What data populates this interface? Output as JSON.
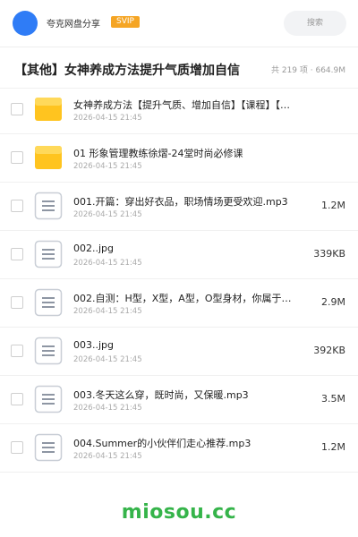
{
  "header": {
    "brand": "夸克网盘分享",
    "badge": "SVIP",
    "search_label": "搜索",
    "accent_color": "#2f7cf6",
    "badge_color": "#f5a524"
  },
  "title": "【其他】女神养成方法提升气质增加自信",
  "summary": "共 219 项 · 664.9M",
  "files": [
    {
      "type": "folder",
      "name": "女神养成方法【提升气质、增加自信】【课程】【音频】",
      "date": "2026-04-15 21:45",
      "size": ""
    },
    {
      "type": "folder",
      "name": "01 形象管理教练徐熠-24堂时尚必修课",
      "date": "2026-04-15 21:45",
      "size": ""
    },
    {
      "type": "file",
      "name": "001.开篇：穿出好衣品，职场情场更受欢迎.mp3",
      "date": "2026-04-15 21:45",
      "size": "1.2M"
    },
    {
      "type": "file",
      "name": "002..jpg",
      "date": "2026-04-15 21:45",
      "size": "339KB"
    },
    {
      "type": "file",
      "name": "002.自测：H型，X型，A型，O型身材，你属于哪…",
      "date": "2026-04-15 21:45",
      "size": "2.9M"
    },
    {
      "type": "file",
      "name": "003..jpg",
      "date": "2026-04-15 21:45",
      "size": "392KB"
    },
    {
      "type": "file",
      "name": "003.冬天这么穿，既时尚，又保暖.mp3",
      "date": "2026-04-15 21:45",
      "size": "3.5M"
    },
    {
      "type": "file",
      "name": "004.Summer的小伙伴们走心推荐.mp3",
      "date": "2026-04-15 21:45",
      "size": "1.2M"
    }
  ],
  "watermark": "miosou.cc",
  "watermark_color": "#35b44a"
}
